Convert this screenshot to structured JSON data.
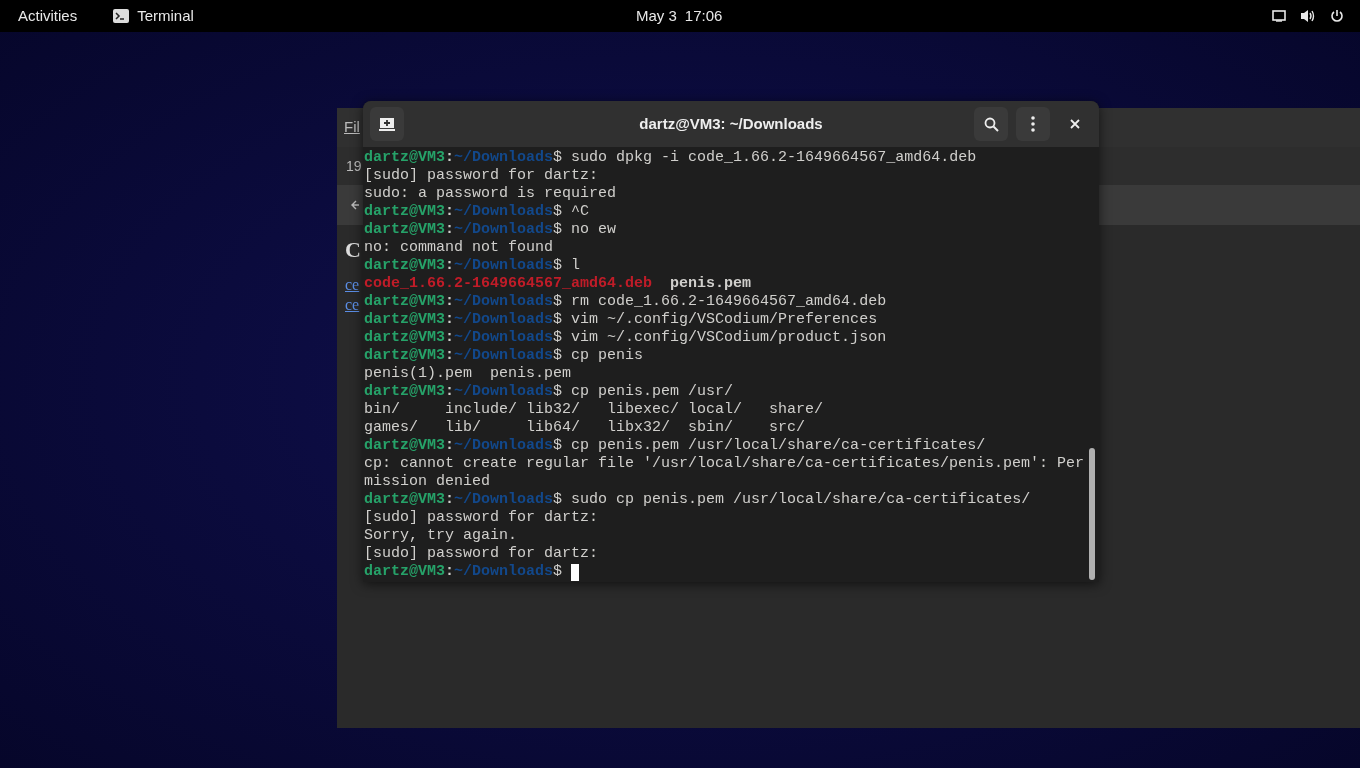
{
  "top_bar": {
    "activities": "Activities",
    "app_name": "Terminal",
    "date": "May 3",
    "time": "17:06"
  },
  "background_window": {
    "menu": "Fil",
    "row_text": "19",
    "heading": "C",
    "links": [
      "ce",
      "ce"
    ]
  },
  "terminal": {
    "title": "dartz@VM3: ~/Downloads",
    "lines": [
      {
        "kind": "prompt",
        "user": "dartz@VM3",
        "separator": ":",
        "path": "~/Downloads",
        "symbol": "$",
        "command": "sudo dpkg -i code_1.66.2-1649664567_amd64.deb"
      },
      {
        "kind": "output",
        "text": "[sudo] password for dartz:"
      },
      {
        "kind": "output",
        "text": "sudo: a password is required"
      },
      {
        "kind": "prompt",
        "user": "dartz@VM3",
        "separator": ":",
        "path": "~/Downloads",
        "symbol": "$",
        "command": "^C"
      },
      {
        "kind": "prompt",
        "user": "dartz@VM3",
        "separator": ":",
        "path": "~/Downloads",
        "symbol": "$",
        "command": "no ew"
      },
      {
        "kind": "output",
        "text": "no: command not found"
      },
      {
        "kind": "prompt",
        "user": "dartz@VM3",
        "separator": ":",
        "path": "~/Downloads",
        "symbol": "$",
        "command": "l"
      },
      {
        "kind": "files",
        "entries": [
          {
            "text": "code_1.66.2-1649664567_amd64.deb",
            "color": "#c01c28"
          },
          {
            "text": "penis.pem",
            "color": "#d0cfcc"
          }
        ]
      },
      {
        "kind": "prompt",
        "user": "dartz@VM3",
        "separator": ":",
        "path": "~/Downloads",
        "symbol": "$",
        "command": "rm code_1.66.2-1649664567_amd64.deb"
      },
      {
        "kind": "prompt",
        "user": "dartz@VM3",
        "separator": ":",
        "path": "~/Downloads",
        "symbol": "$",
        "command": "vim ~/.config/VSCodium/Preferences"
      },
      {
        "kind": "prompt",
        "user": "dartz@VM3",
        "separator": ":",
        "path": "~/Downloads",
        "symbol": "$",
        "command": "vim ~/.config/VSCodium/product.json"
      },
      {
        "kind": "prompt",
        "user": "dartz@VM3",
        "separator": ":",
        "path": "~/Downloads",
        "symbol": "$",
        "command": "cp penis"
      },
      {
        "kind": "output",
        "text": "penis(1).pem  penis.pem"
      },
      {
        "kind": "prompt",
        "user": "dartz@VM3",
        "separator": ":",
        "path": "~/Downloads",
        "symbol": "$",
        "command": "cp penis.pem /usr/"
      },
      {
        "kind": "output",
        "text": "bin/     include/ lib32/   libexec/ local/   share/"
      },
      {
        "kind": "output",
        "text": "games/   lib/     lib64/   libx32/  sbin/    src/"
      },
      {
        "kind": "prompt",
        "user": "dartz@VM3",
        "separator": ":",
        "path": "~/Downloads",
        "symbol": "$",
        "command": "cp penis.pem /usr/local/share/ca-certificates/"
      },
      {
        "kind": "output",
        "text": "cp: cannot create regular file '/usr/local/share/ca-certificates/penis.pem': Per"
      },
      {
        "kind": "output",
        "text": "mission denied"
      },
      {
        "kind": "prompt",
        "user": "dartz@VM3",
        "separator": ":",
        "path": "~/Downloads",
        "symbol": "$",
        "command": "sudo cp penis.pem /usr/local/share/ca-certificates/"
      },
      {
        "kind": "output",
        "text": "[sudo] password for dartz:"
      },
      {
        "kind": "output",
        "text": "Sorry, try again."
      },
      {
        "kind": "output",
        "text": "[sudo] password for dartz:"
      },
      {
        "kind": "prompt",
        "user": "dartz@VM3",
        "separator": ":",
        "path": "~/Downloads",
        "symbol": "$",
        "cursor": true
      }
    ]
  }
}
